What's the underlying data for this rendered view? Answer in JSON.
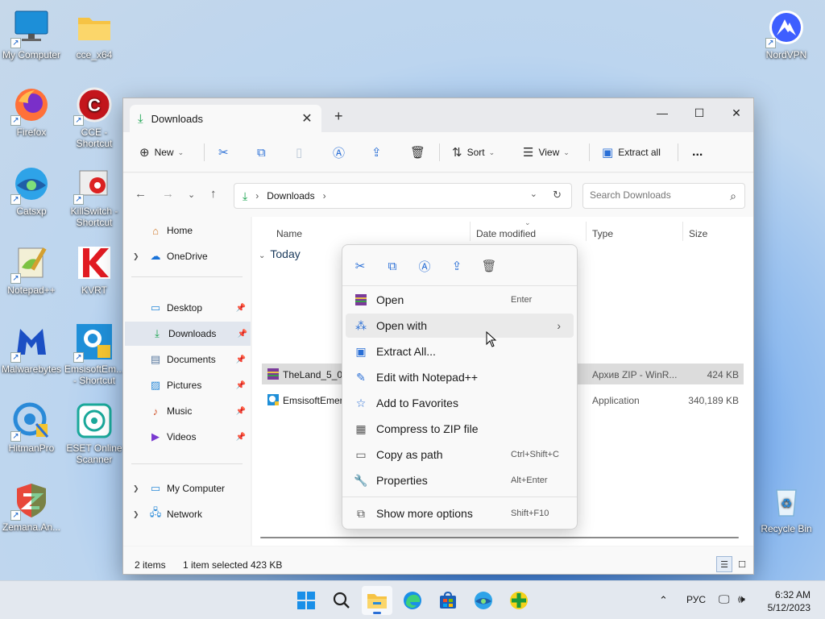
{
  "desktop": {
    "icons_left": [
      {
        "label": "My Computer"
      },
      {
        "label": "Firefox"
      },
      {
        "label": "Catsxp"
      },
      {
        "label": "Notepad++"
      },
      {
        "label": "Malwarebytes"
      },
      {
        "label": "HitmanPro"
      },
      {
        "label": "Zemana.An..."
      }
    ],
    "icons_second": [
      {
        "label": "cce_x64"
      },
      {
        "label": "CCE - Shortcut"
      },
      {
        "label": "KillSwitch - Shortcut"
      },
      {
        "label": "KVRT"
      },
      {
        "label": "EmsisoftEm... - Shortcut"
      },
      {
        "label": "ESET Online Scanner"
      }
    ],
    "icon_nordvpn": "NordVPN",
    "icon_recycle": "Recycle Bin"
  },
  "window": {
    "tab_title": "Downloads",
    "toolbar": {
      "new_label": "New",
      "sort_label": "Sort",
      "view_label": "View",
      "extract_label": "Extract all",
      "more_label": "..."
    },
    "address": {
      "crumb": "Downloads",
      "search_placeholder": "Search Downloads"
    },
    "sidebar": {
      "home": "Home",
      "onedrive": "OneDrive",
      "desktop": "Desktop",
      "downloads": "Downloads",
      "documents": "Documents",
      "pictures": "Pictures",
      "music": "Music",
      "videos": "Videos",
      "mycomputer": "My Computer",
      "network": "Network"
    },
    "columns": {
      "name": "Name",
      "date": "Date modified",
      "type": "Type",
      "size": "Size"
    },
    "group": "Today",
    "files": [
      {
        "name": "TheLand_5_0_",
        "type": "Архив ZIP - WinR...",
        "size": "424 KB"
      },
      {
        "name": "EmsisoftEmer",
        "type": "Application",
        "size": "340,189 KB"
      }
    ],
    "status": {
      "count": "2 items",
      "selected": "1 item selected",
      "size": "423 KB"
    }
  },
  "context_menu": {
    "items": [
      {
        "label": "Open",
        "shortcut": "Enter"
      },
      {
        "label": "Open with",
        "shortcut": ""
      },
      {
        "label": "Extract All...",
        "shortcut": ""
      },
      {
        "label": "Edit with Notepad++",
        "shortcut": ""
      },
      {
        "label": "Add to Favorites",
        "shortcut": ""
      },
      {
        "label": "Compress to ZIP file",
        "shortcut": ""
      },
      {
        "label": "Copy as path",
        "shortcut": "Ctrl+Shift+C"
      },
      {
        "label": "Properties",
        "shortcut": "Alt+Enter"
      },
      {
        "label": "Show more options",
        "shortcut": "Shift+F10"
      }
    ]
  },
  "taskbar": {
    "lang": "РУС",
    "time": "6:32 AM",
    "date": "5/12/2023"
  },
  "colors": {
    "accent": "#2a6fd6",
    "green": "#12a14a"
  }
}
